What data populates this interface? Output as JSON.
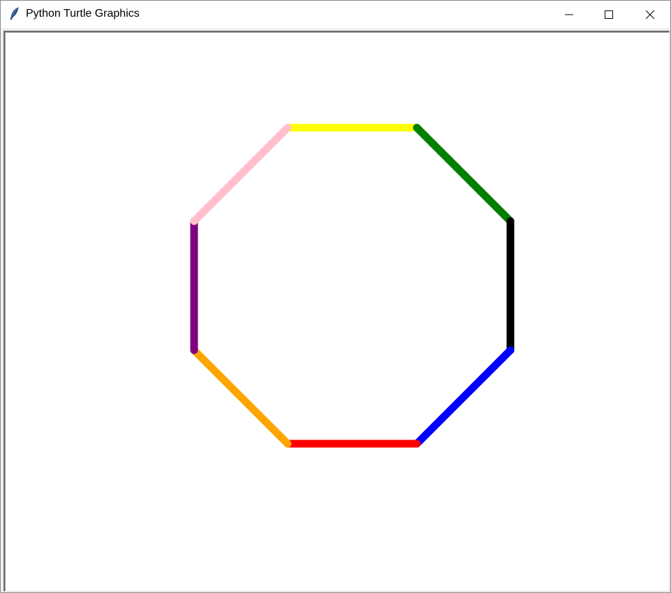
{
  "window": {
    "title": "Python Turtle Graphics"
  },
  "icons": {
    "app": "feather-icon",
    "minimize": "minimize-icon",
    "maximize": "maximize-icon",
    "close": "close-icon"
  },
  "drawing": {
    "shape": "octagon",
    "segments": [
      {
        "color": "#ffff00",
        "name": "yellow"
      },
      {
        "color": "#008000",
        "name": "green"
      },
      {
        "color": "#000000",
        "name": "black"
      },
      {
        "color": "#0000ff",
        "name": "blue"
      },
      {
        "color": "#ff0000",
        "name": "red"
      },
      {
        "color": "#ffa500",
        "name": "orange"
      },
      {
        "color": "#800080",
        "name": "purple"
      },
      {
        "color": "#ffc0cb",
        "name": "pink"
      }
    ]
  }
}
